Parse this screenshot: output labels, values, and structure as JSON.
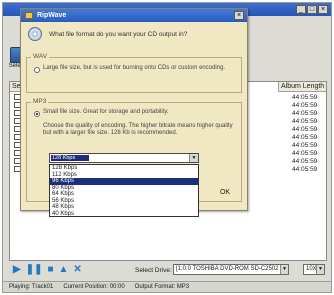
{
  "main": {
    "toolbar": {
      "select_label": "Select"
    },
    "table": {
      "col_select": "Select",
      "col_album_length": "Album Length",
      "row_count": 10,
      "lengths": [
        "44:05:59",
        "44:05:59",
        "44:05:59",
        "44:05:59",
        "44:05:59",
        "44:05:59",
        "44:05:59",
        "44:05:59",
        "44:05:59",
        "44:05:59"
      ]
    },
    "controls": {
      "icons": [
        "play-icon",
        "pause-icon",
        "stop-icon",
        "eject-icon",
        "shuffle-icon"
      ]
    },
    "drive": {
      "label": "Select Drive:",
      "value": "[1:0:0  TOSHIBA DVD-ROM SD-C2502",
      "speed": "10X"
    },
    "status": {
      "playing": "Playing: Track01",
      "position": "Current Position: 00:00",
      "format": "Output Format:  MP3"
    }
  },
  "dialog": {
    "title": "RipWave",
    "close_glyph": "×",
    "question": "What file format do you want your CD output in?",
    "wav": {
      "group_label": "WAV",
      "option_text": "Large file size, but is used for burning onto CDs or custom encoding."
    },
    "mp3": {
      "group_label": "MP3",
      "option_text": "Small file size. Great for storage and portability.",
      "description": "Choose the quality of encoding. The higher bitrate means higher quality but with a larger file size. 128 Kb is recommended.",
      "selected_quality": "128 Kbps",
      "options": [
        "128 Kbps",
        "112 Kbps",
        "96 Kbps",
        "80 Kbps",
        "64 Kbps",
        "56 Kbps",
        "48 Kbps",
        "40 Kbps"
      ],
      "highlighted_index": 2
    },
    "ok_label": "OK"
  },
  "colors": {
    "dialog_bg": "#efe8c2",
    "titlebar": "#285cc0",
    "highlight": "#1d2e7a",
    "controls_accent": "#1f78c8"
  }
}
